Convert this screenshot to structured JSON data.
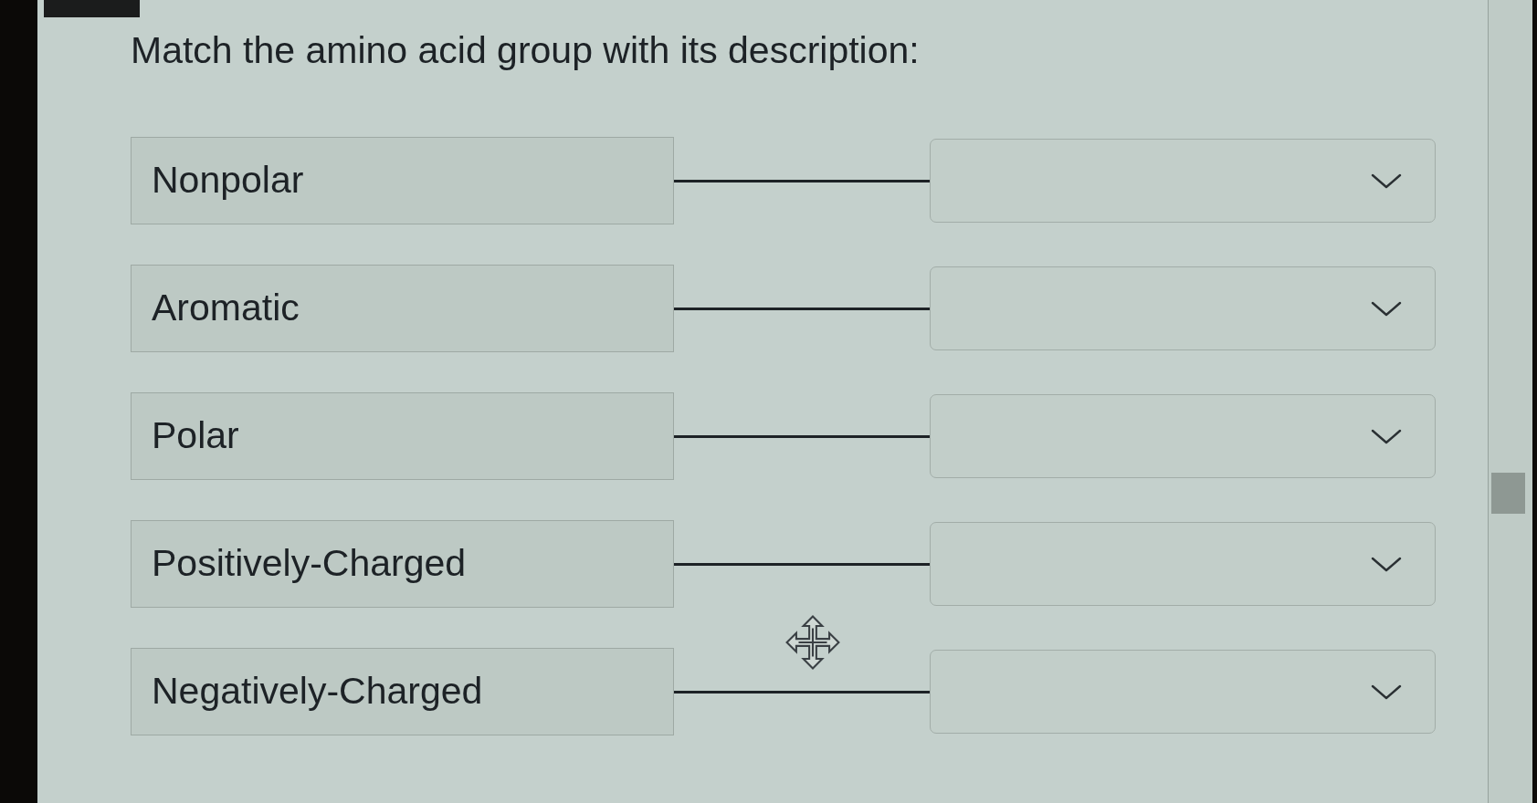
{
  "prompt": "Match the amino acid group with its description:",
  "pairs": [
    {
      "term": "Nonpolar"
    },
    {
      "term": "Aromatic"
    },
    {
      "term": "Polar"
    },
    {
      "term": "Positively-Charged"
    },
    {
      "term": "Negatively-Charged"
    }
  ]
}
